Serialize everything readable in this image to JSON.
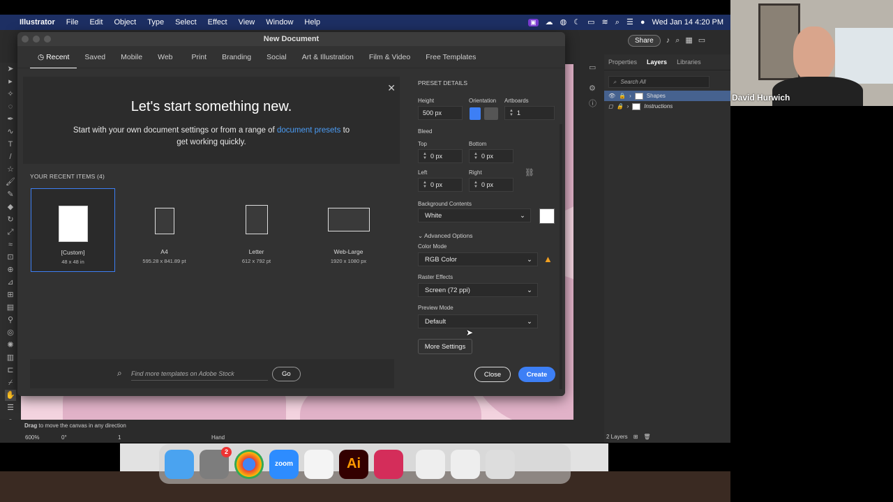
{
  "menubar": {
    "app": "Illustrator",
    "items": [
      "File",
      "Edit",
      "Object",
      "Type",
      "Select",
      "Effect",
      "View",
      "Window",
      "Help"
    ],
    "clock": "Wed Jan 14  4:20 PM"
  },
  "topbar": {
    "share": "Share"
  },
  "dialog": {
    "title": "New Document",
    "tabs": [
      "Recent",
      "Saved",
      "Mobile",
      "Web",
      "Print",
      "Branding",
      "Social",
      "Art & Illustration",
      "Film & Video",
      "Free Templates"
    ],
    "welcome": {
      "heading": "Let's start something new.",
      "line1": "Start with your own document settings or from a range of",
      "link": "document presets",
      "line1_end": "to",
      "line2": "get working quickly."
    },
    "recent_header": "YOUR RECENT ITEMS  (4)",
    "recent_items": [
      {
        "name": "[Custom]",
        "size": "48 x 48 in"
      },
      {
        "name": "A4",
        "size": "595.28 x 841.89 pt"
      },
      {
        "name": "Letter",
        "size": "612 x 792 pt"
      },
      {
        "name": "Web-Large",
        "size": "1920 x 1080 px"
      }
    ],
    "stock_placeholder": "Find more templates on Adobe Stock",
    "go": "Go",
    "preset": {
      "header": "PRESET DETAILS",
      "height_label": "Height",
      "height_value": "500 px",
      "orientation_label": "Orientation",
      "artboards_label": "Artboards",
      "artboards_value": "1",
      "bleed_label": "Bleed",
      "top_label": "Top",
      "top_value": "0 px",
      "bottom_label": "Bottom",
      "bottom_value": "0 px",
      "left_label": "Left",
      "left_value": "0 px",
      "right_label": "Right",
      "right_value": "0 px",
      "bg_label": "Background Contents",
      "bg_value": "White",
      "advanced": "Advanced Options",
      "color_mode_label": "Color Mode",
      "color_mode_value": "RGB Color",
      "raster_label": "Raster Effects",
      "raster_value": "Screen (72 ppi)",
      "preview_label": "Preview Mode",
      "preview_value": "Default",
      "more_settings": "More Settings",
      "close": "Close",
      "create": "Create"
    }
  },
  "right_panel": {
    "tabs": [
      "Properties",
      "Layers",
      "Libraries"
    ],
    "search": "Search All",
    "layers": [
      "Shapes",
      "Instructions"
    ],
    "footer": "2 Layers"
  },
  "status": {
    "hint_bold": "Drag",
    "hint": "to move the canvas in any direction",
    "zoom": "600%",
    "rotate": "0°",
    "artboard": "1",
    "tool": "Hand"
  },
  "webcam": {
    "name": "David Hurwich"
  },
  "dock": {
    "badge": "2",
    "zoom": "zoom",
    "ai": "Ai"
  },
  "colors": {
    "accent": "#3d7ff5",
    "link": "#4b9cf5",
    "menubar": "#1d2f63",
    "canvas": "#f3d3df",
    "layer_sel": "#46628f"
  }
}
